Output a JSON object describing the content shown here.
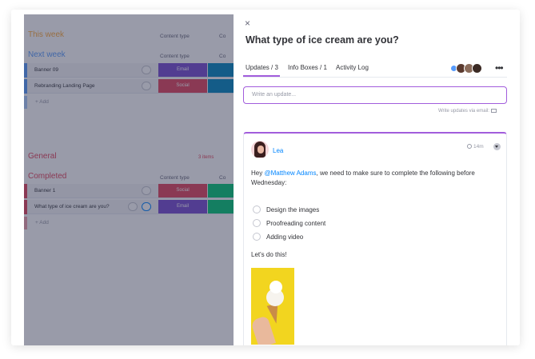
{
  "board": {
    "groups": [
      {
        "title": "This week",
        "title_color": "#fdab3d",
        "column_header": "Content type",
        "column_header_2": "Co",
        "rows": [],
        "add_label": ""
      },
      {
        "title": "Next week",
        "title_color": "#579bfc",
        "column_header": "Content type",
        "column_header_2": "Co",
        "rows": [
          {
            "name": "Banner 09",
            "status": "Email",
            "status_color": "#784bd1",
            "bar_color": "#579bfc",
            "extra_color": "#0086c0"
          },
          {
            "name": "Rebranding Landing Page",
            "status": "Social",
            "status_color": "#e2445c",
            "bar_color": "#579bfc",
            "extra_color": "#0086c0"
          }
        ],
        "add_label": "+ Add"
      },
      {
        "title": "General",
        "title_color": "#e2445c",
        "count": "3 items"
      },
      {
        "title": "Completed",
        "title_color": "#e2445c",
        "column_header": "Content type",
        "column_header_2": "Co",
        "rows": [
          {
            "name": "Banner 1",
            "status": "Social",
            "status_color": "#e2445c",
            "bar_color": "#e2445c",
            "extra_color": "#00c875"
          },
          {
            "name": "What type of ice cream are you?",
            "status": "Email",
            "status_color": "#784bd1",
            "bar_color": "#e2445c",
            "extra_color": "#00c875"
          }
        ],
        "add_label": "+ Add"
      }
    ]
  },
  "panel": {
    "close_icon": "×",
    "title": "What type of ice cream are you?",
    "tabs": [
      {
        "label": "Updates / 3",
        "active": true
      },
      {
        "label": "Info Boxes / 1",
        "active": false
      },
      {
        "label": "Activity Log",
        "active": false
      }
    ],
    "more_icon": "•••",
    "write_placeholder": "Write an update...",
    "via_email": "Write updates via email:",
    "accent": "#a25ddc",
    "post": {
      "author": "Lea",
      "time": "14m",
      "text_before": "Hey ",
      "mention": "@Matthew Adams",
      "text_after": ", we need to make sure to complete the following before Wednesday:",
      "checklist": [
        "Design the images",
        "Proofreading content",
        "Adding video"
      ],
      "closing": "Let's do this!"
    }
  }
}
